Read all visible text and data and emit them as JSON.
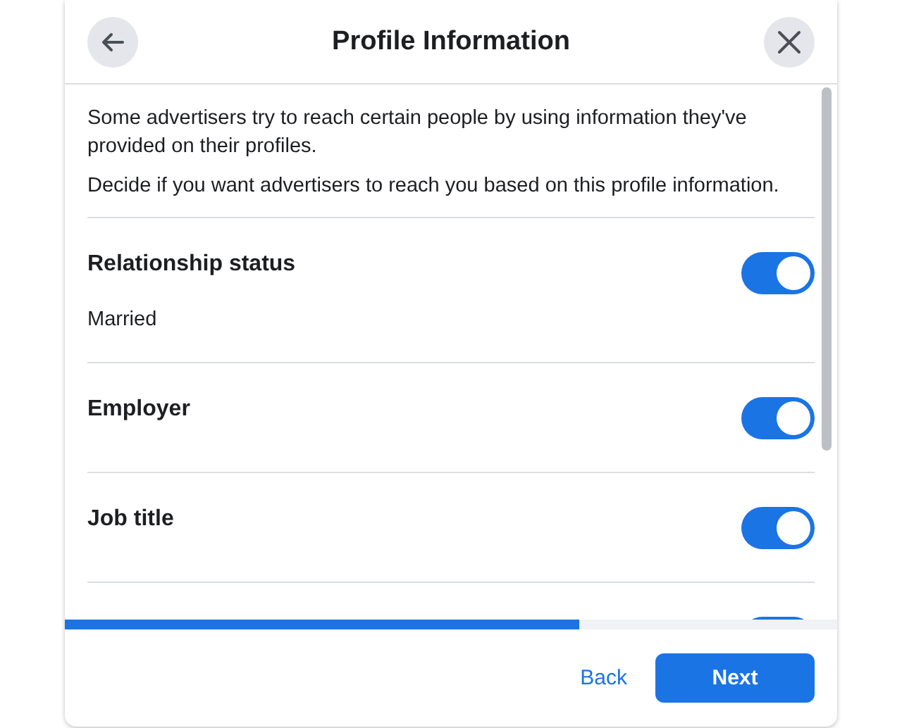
{
  "header": {
    "title": "Profile Information"
  },
  "intro": [
    "Some advertisers try to reach certain people by using information they've provided on their profiles.",
    "Decide if you want advertisers to reach you based on this profile information."
  ],
  "settings": [
    {
      "label": "Relationship status",
      "value": "Married",
      "on": true
    },
    {
      "label": "Employer",
      "on": true
    },
    {
      "label": "Job title",
      "on": true
    },
    {
      "on": true
    }
  ],
  "progress": {
    "level": 0.666
  },
  "footer": {
    "back": "Back",
    "next": "Next"
  }
}
